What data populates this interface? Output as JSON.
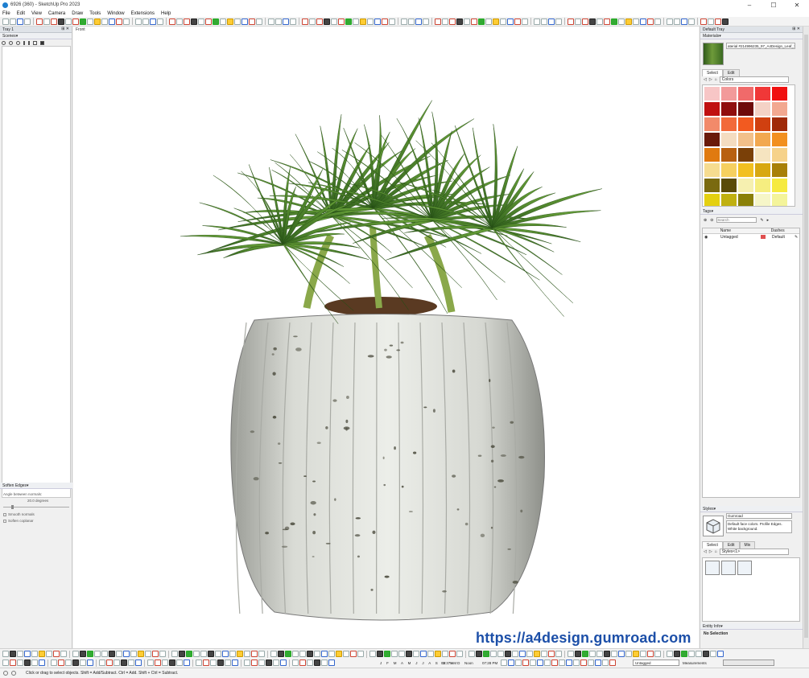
{
  "window": {
    "title": "6926 (360) - SketchUp Pro 2023",
    "minimize": "–",
    "maximize": "☐",
    "close": "✕"
  },
  "menu": [
    "File",
    "Edit",
    "View",
    "Camera",
    "Draw",
    "Tools",
    "Window",
    "Extensions",
    "Help"
  ],
  "left_tray": {
    "tray_title": "Tray 1",
    "scenes_title": "Scenes",
    "soften_title": "Soften Edges",
    "angle_label": "Angle between normals:",
    "angle_value": "20.0",
    "angle_unit": "degrees",
    "smooth_normals": "Smooth normals",
    "soften_coplanar": "Soften coplanar"
  },
  "viewport": {
    "view_label": "Front",
    "watermark": "https://a4design.gumroad.com"
  },
  "right_tray": {
    "tray_title": "Default Tray",
    "materials_title": "Materials",
    "material_name": "aterial #214996235_97_A4Design_Leaf_15",
    "tab_select": "Select",
    "tab_edit": "Edit",
    "colors_dropdown": "Colors",
    "swatch_colors": [
      "#f7c6c6",
      "#f29a9a",
      "#f06a6a",
      "#f03838",
      "#f01010",
      "#c01010",
      "#900e0e",
      "#6e0a0a",
      "#f4d2c6",
      "#f2a890",
      "#f28a6a",
      "#f26a3a",
      "#f25a20",
      "#d04010",
      "#a02a08",
      "#6a1a0a",
      "#f4dcc0",
      "#f2c08a",
      "#f2a850",
      "#f29020",
      "#e07a10",
      "#b86010",
      "#7a4008",
      "#f6e4c0",
      "#f6d28a",
      "#f6dc90",
      "#f6d060",
      "#f2c020",
      "#d8a810",
      "#a88008",
      "#7a6a10",
      "#5a4a08",
      "#f6f0b0",
      "#f6ee80",
      "#f6ea40",
      "#e4d010",
      "#c0b010",
      "#8a8008",
      "#f6f6c8",
      "#f4f49a"
    ],
    "tags_title": "Tags",
    "tags_search_placeholder": "Search",
    "tags_col_name": "Name",
    "tags_col_dashes": "Dashes",
    "tags_rows": [
      {
        "name": "Untagged",
        "dashes": "Default",
        "color": "#e05050"
      }
    ],
    "styles_title": "Styles",
    "style_name": "Gumroad",
    "style_desc": "Default face colors. Profile Edges. White background.",
    "styles_tab_select": "Select",
    "styles_tab_edit": "Edit",
    "styles_tab_mix": "Mix",
    "styles_dropdown": "Styles<1>",
    "entity_info_title": "Entity Info",
    "entity_info_value": "No Selection"
  },
  "bottom": {
    "months": "J F M A M J J A S O N D",
    "time1": "04:37 AM",
    "noon": "Noon",
    "time2": "07:28 PM",
    "tag_dropdown": "Untagged",
    "measurements_label": "Measurements"
  },
  "status": {
    "text": "Click or drag to select objects. Shift = Add/Subtract. Ctrl = Add. Shift + Ctrl = Subtract."
  }
}
